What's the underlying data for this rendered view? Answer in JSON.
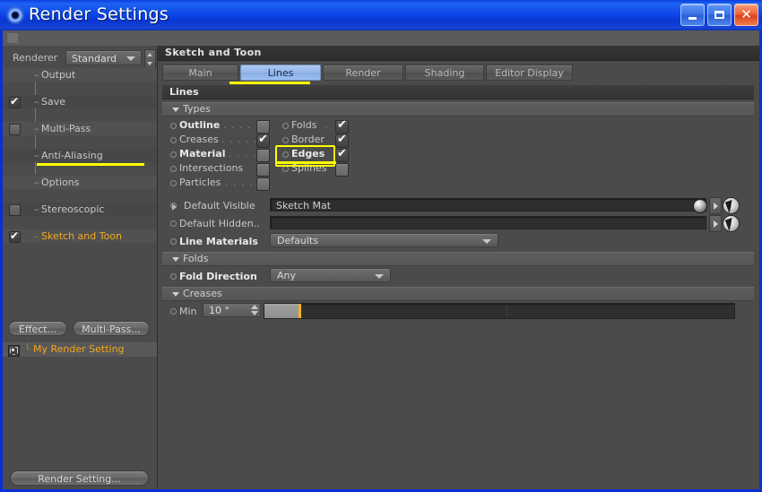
{
  "window": {
    "title": "Render Settings",
    "icon": "app-render-icon",
    "buttons": {
      "minimize": "_",
      "maximize": "□",
      "close": "✕"
    }
  },
  "left_panel": {
    "renderer_label": "Renderer",
    "renderer_value": "Standard",
    "tree": [
      {
        "label": "Output",
        "checkbox": "none"
      },
      {
        "label": "Save",
        "checkbox": "checked"
      },
      {
        "label": "Multi-Pass",
        "checkbox": "unchecked"
      },
      {
        "label": "Anti-Aliasing",
        "checkbox": "none"
      },
      {
        "label": "Options",
        "checkbox": "none"
      },
      {
        "label": "Stereoscopic",
        "checkbox": "unchecked"
      },
      {
        "label": "Sketch and Toon",
        "checkbox": "checked",
        "selected": true
      }
    ],
    "buttons": {
      "effect": "Effect...",
      "multipass": "Multi-Pass...",
      "render_setting": "Render Setting..."
    },
    "scene_item": "My Render Setting"
  },
  "right_panel": {
    "header": "Sketch and Toon",
    "tabs": [
      {
        "label": "Main",
        "active": false
      },
      {
        "label": "Lines",
        "active": true
      },
      {
        "label": "Render",
        "active": false
      },
      {
        "label": "Shading",
        "active": false
      },
      {
        "label": "Editor Display",
        "active": false
      }
    ],
    "group_title": "Lines",
    "sections": {
      "types": {
        "title": "Types",
        "left_column": [
          {
            "label": "Outline",
            "bold": true,
            "state": "unchecked",
            "dots": ". . . . ."
          },
          {
            "label": "Creases",
            "bold": false,
            "state": "checked",
            "dots": ". . . . ."
          },
          {
            "label": "Material",
            "bold": true,
            "state": "unchecked",
            "dots": ". . . ."
          },
          {
            "label": "Intersections",
            "bold": false,
            "state": "unchecked",
            "dots": ""
          },
          {
            "label": "Particles",
            "bold": false,
            "state": "unchecked",
            "dots": ". . . ."
          }
        ],
        "right_column": [
          {
            "label": "Folds",
            "bold": false,
            "state": "checked",
            "dots": "."
          },
          {
            "label": "Border",
            "bold": false,
            "state": "checked",
            "dots": ""
          },
          {
            "label": "Edges",
            "bold": true,
            "state": "checked",
            "dots": "",
            "highlighted": true
          },
          {
            "label": "Splines",
            "bold": false,
            "state": "unchecked",
            "dots": ""
          }
        ]
      },
      "materials": {
        "default_visible_label": "Default Visible",
        "default_visible_value": "Sketch Mat",
        "default_hidden_label": "Default Hidden..",
        "default_hidden_value": "",
        "line_materials_label": "Line Materials",
        "line_materials_value": "Defaults"
      },
      "folds": {
        "title": "Folds",
        "fold_direction_label": "Fold Direction",
        "fold_direction_value": "Any"
      },
      "creases": {
        "title": "Creases",
        "min_label": "Min",
        "min_value": "10 °"
      }
    }
  },
  "colors": {
    "highlight_yellow": "#ffff00",
    "selected_tab_blue": "#95b8ea",
    "selected_item_orange": "#f3a81e",
    "slider_knob_orange": "#ffb01e",
    "panel_grey": "#4b4b4b",
    "titlebar_blue": "#0b45e8"
  }
}
